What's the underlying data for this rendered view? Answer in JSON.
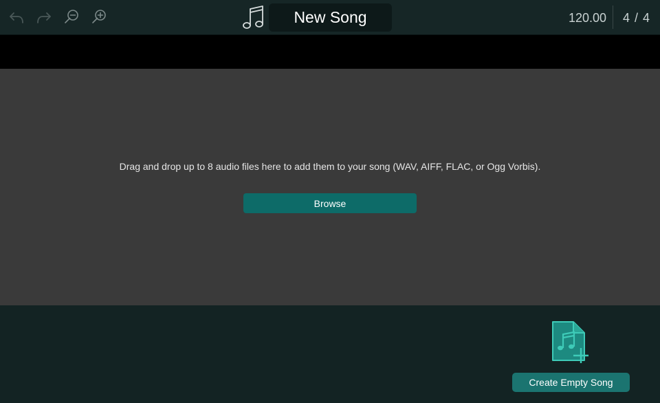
{
  "toolbar": {
    "buttons": [
      {
        "icon": "undo-icon"
      },
      {
        "icon": "redo-icon"
      },
      {
        "icon": "zoom-out-icon"
      },
      {
        "icon": "zoom-in-icon"
      }
    ],
    "song_icon": "music-note-icon",
    "song_title": "New Song",
    "tempo": "120.00",
    "time_signature": "4 / 4"
  },
  "drop_area": {
    "instructions": "Drag and drop up to 8 audio files here to add them to your song (WAV, AIFF, FLAC, or Ogg Vorbis).",
    "browse_label": "Browse"
  },
  "bottom": {
    "new_song_icon": "new-song-file-icon",
    "create_label": "Create Empty Song"
  },
  "colors": {
    "accent": "#0d6b68",
    "accent_light": "#3ecbb8",
    "toolbar_bg": "#162626",
    "drop_bg": "#3a3a3a"
  }
}
